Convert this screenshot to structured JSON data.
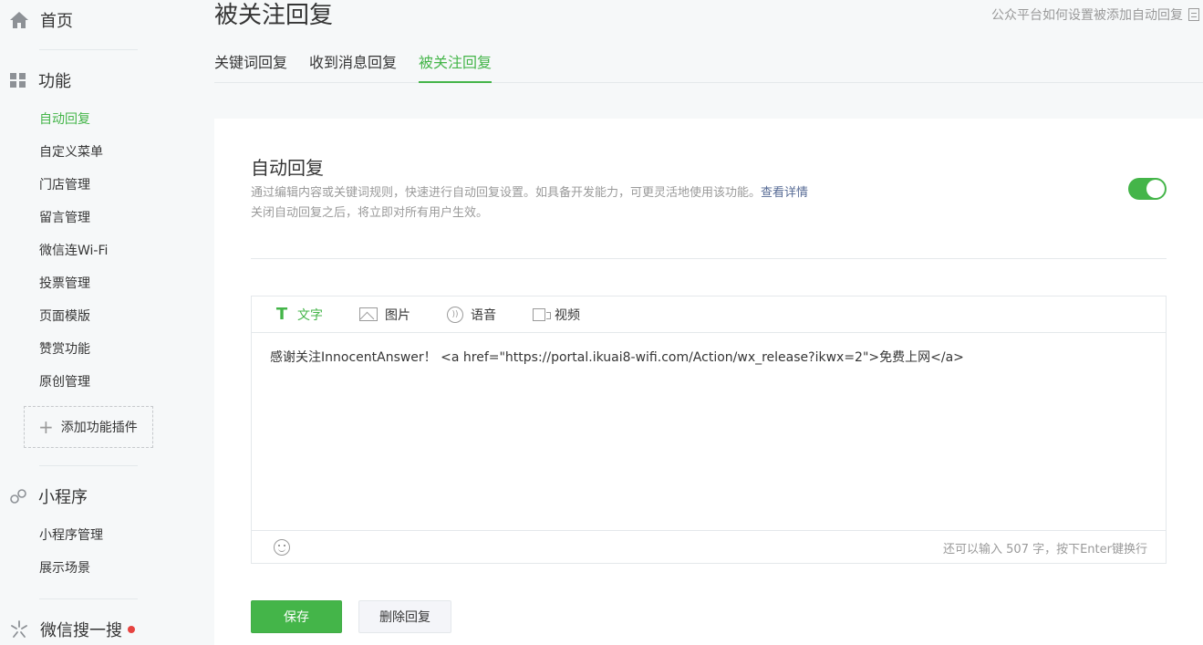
{
  "sidebar": {
    "home": "首页",
    "function_group": "功能",
    "function_items": [
      "自动回复",
      "自定义菜单",
      "门店管理",
      "留言管理",
      "微信连Wi-Fi",
      "投票管理",
      "页面模版",
      "赞赏功能",
      "原创管理"
    ],
    "add_plugin": "添加功能插件",
    "miniprogram_group": "小程序",
    "miniprogram_items": [
      "小程序管理",
      "展示场景"
    ],
    "search_group": "微信搜一搜"
  },
  "header": {
    "title": "被关注回复",
    "help_link": "公众平台如何设置被添加自动回复"
  },
  "tabs": [
    "关键词回复",
    "收到消息回复",
    "被关注回复"
  ],
  "card": {
    "title": "自动回复",
    "desc_line1": "通过编辑内容或关键词规则，快速进行自动回复设置。如具备开发能力，可更灵活地使用该功能。",
    "desc_link": "查看详情",
    "desc_line2": "关闭自动回复之后，将立即对所有用户生效。",
    "toggle_on": true
  },
  "editor": {
    "tabs": [
      "文字",
      "图片",
      "语音",
      "视频"
    ],
    "content": "感谢关注InnocentAnswer！ <a href=\"https://portal.ikuai8-wifi.com/Action/wx_release?ikwx=2\">免费上网</a>",
    "char_count": "还可以输入 507 字，按下Enter键换行"
  },
  "buttons": {
    "save": "保存",
    "delete": "删除回复"
  },
  "colors": {
    "accent": "#44b549",
    "link": "#576b95",
    "badge": "#e64340"
  }
}
